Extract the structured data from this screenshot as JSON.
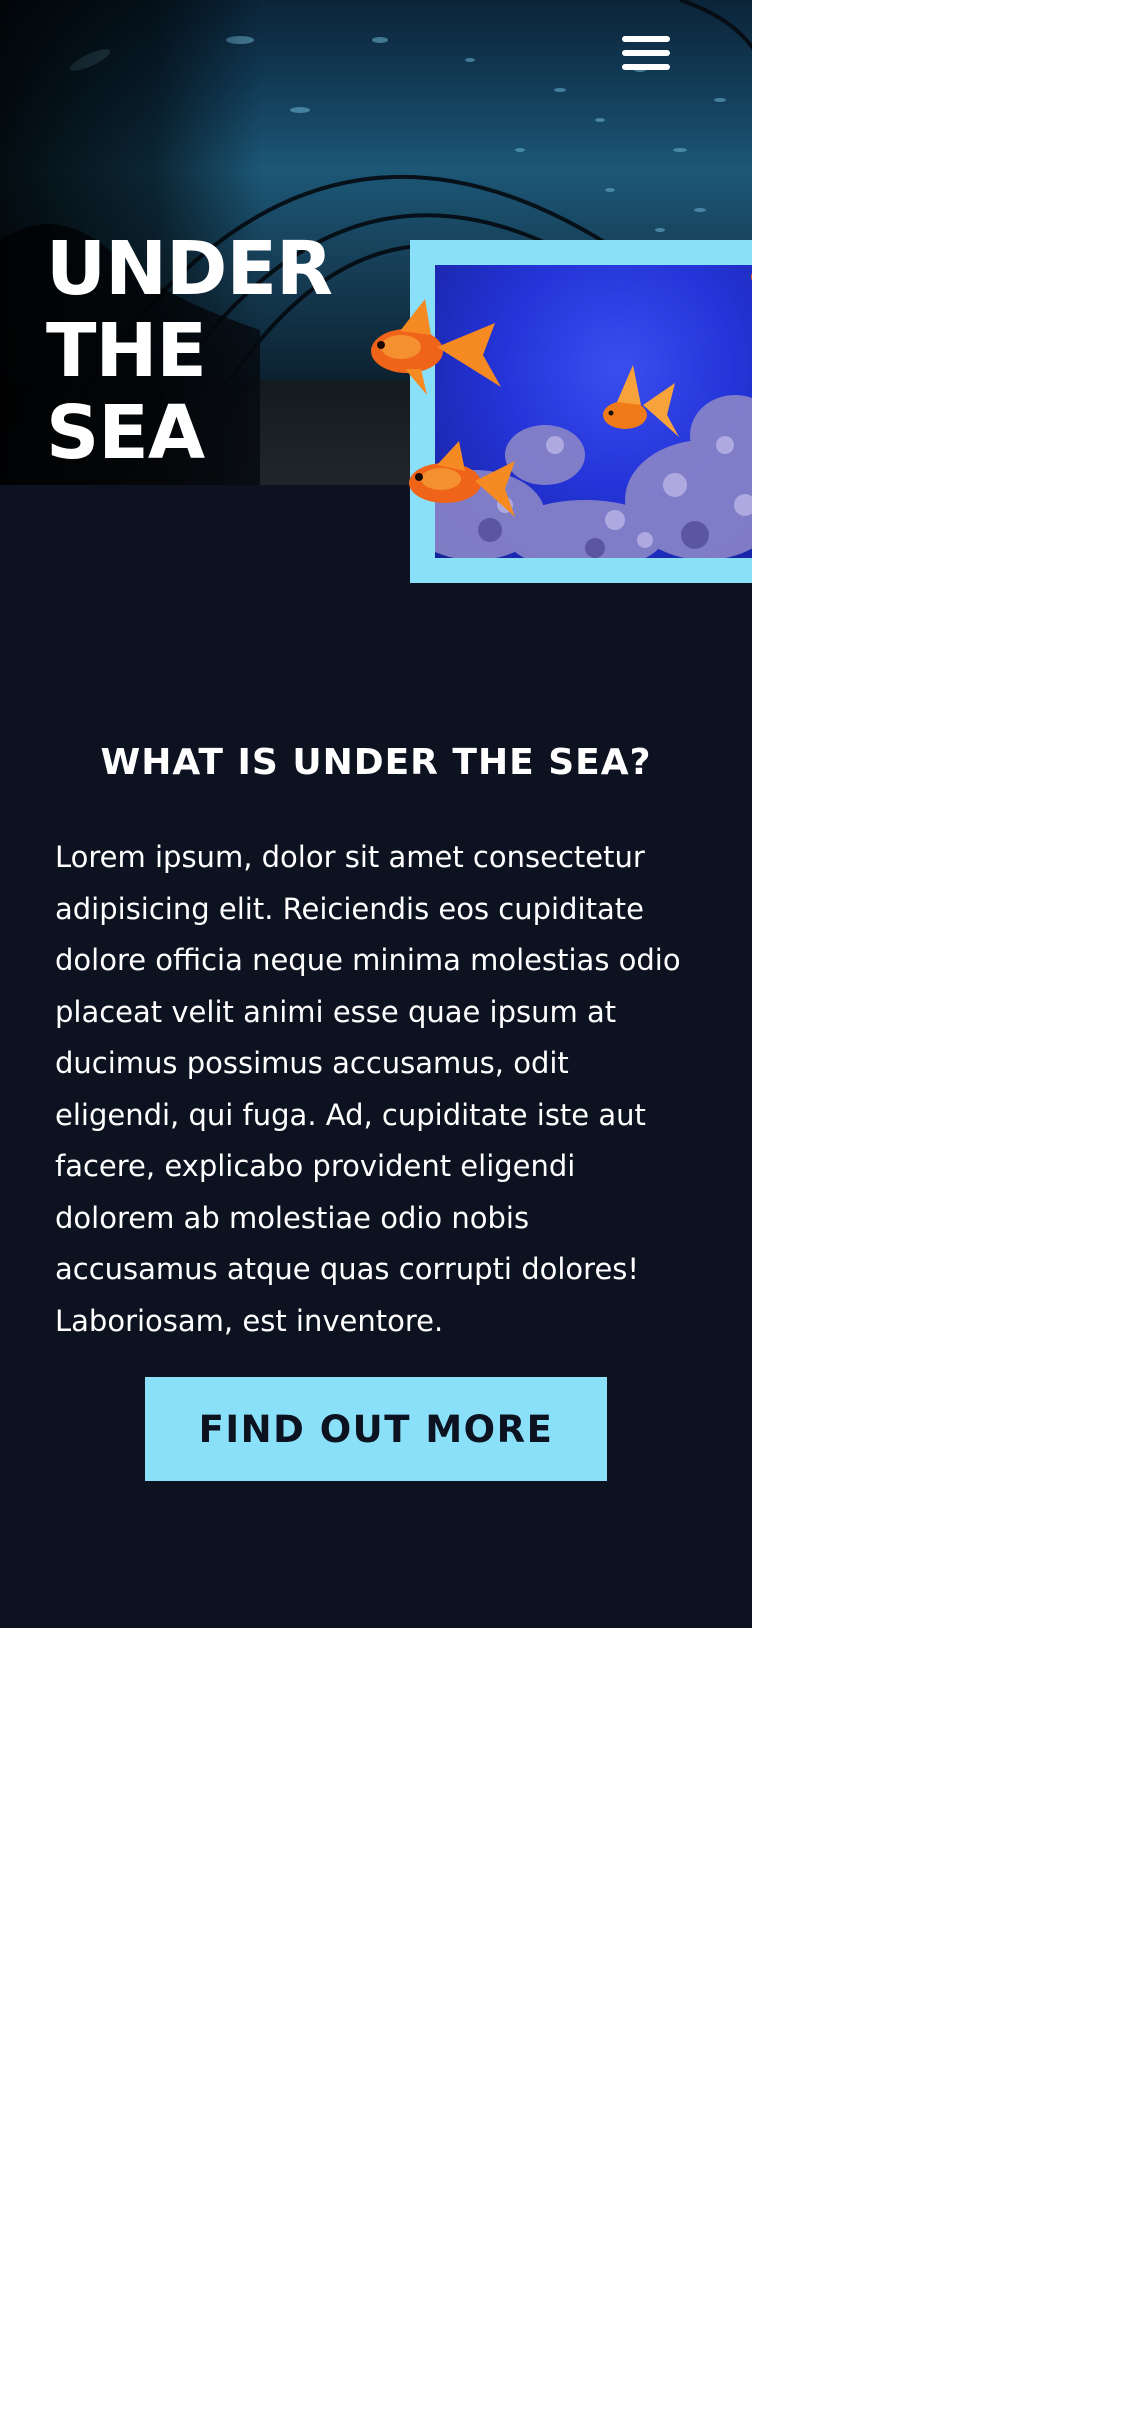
{
  "header": {
    "menu_icon": "hamburger-menu-icon"
  },
  "hero": {
    "title": "UNDER\nTHE\nSEA",
    "background_image": "underwater-tunnel-aquarium",
    "featured_image": "goldfish-aquarium"
  },
  "content": {
    "heading": "WHAT IS UNDER THE SEA?",
    "body": "Lorem ipsum, dolor sit amet consectetur adipisicing elit. Reiciendis eos cupiditate dolore officia neque minima molestias odio placeat velit animi esse quae ipsum at ducimus possimus accusamus, odit eligendi, qui fuga. Ad, cupiditate iste aut facere, explicabo provident eligendi dolorem ab molestiae odio nobis accusamus atque quas corrupti dolores! Laboriosam, est inventore.",
    "cta_label": "FIND OUT MORE"
  },
  "colors": {
    "page_background": "#0c1220",
    "accent": "#8ae0f8",
    "text": "#ffffff"
  }
}
